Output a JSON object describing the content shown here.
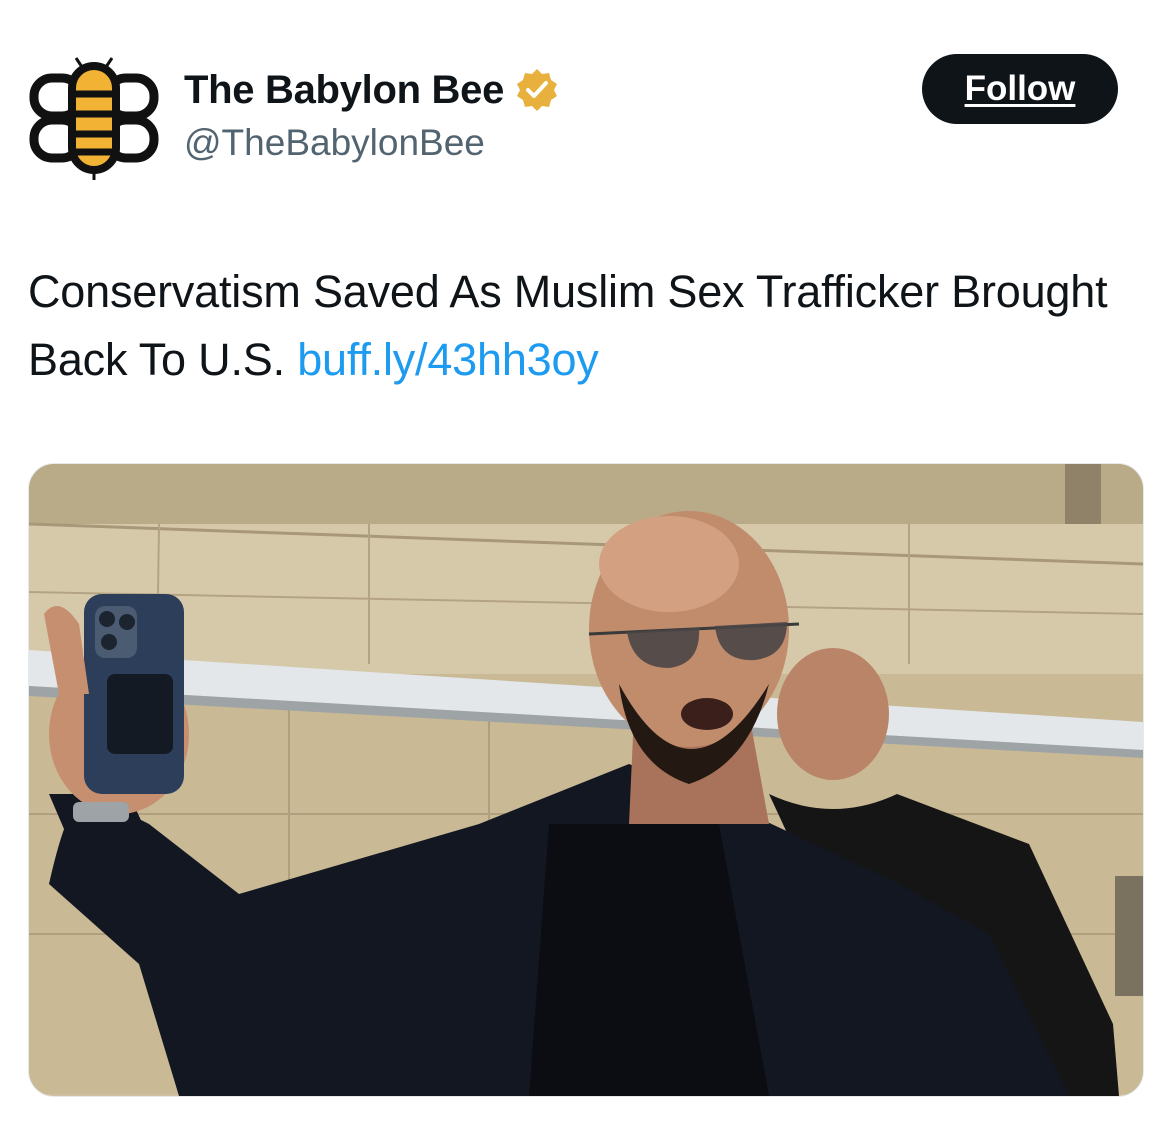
{
  "author": {
    "display_name": "The Babylon Bee",
    "handle": "@TheBabylonBee",
    "verified_badge_icon": "gold-verified-badge-icon",
    "avatar_icon": "babylon-bee-logo-icon",
    "badge_color": "#e8b03c"
  },
  "actions": {
    "follow_label": "Follow"
  },
  "tweet": {
    "text": "Conservatism Saved As Muslim Sex Trafficker Brought Back To U.S.",
    "link_text": "buff.ly/43hh3oy"
  },
  "colors": {
    "link": "#1d9bf0",
    "follow_bg": "#0f1419",
    "handle": "#536471"
  }
}
